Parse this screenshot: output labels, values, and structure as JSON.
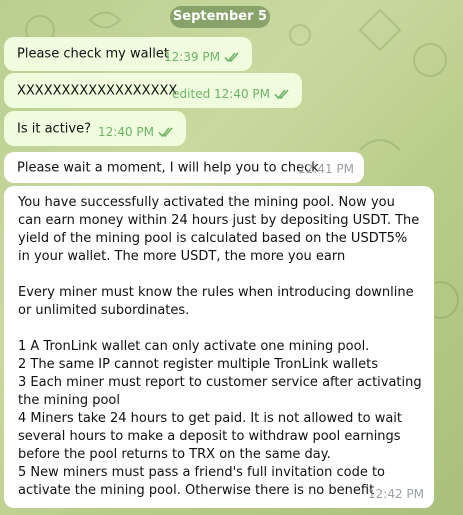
{
  "date": "September 5",
  "messages": [
    {
      "text": "Please check my wallet",
      "time": "12:39 PM"
    },
    {
      "text": "XXXXXXXXXXXXXXXXXX",
      "time": "edited 12:40 PM"
    },
    {
      "text": "Is it active?",
      "time": "12:40 PM"
    },
    {
      "text": "Please wait a moment, I will help you to check",
      "time": "12:41 PM"
    }
  ],
  "long_message": {
    "para1": "You have successfully activated the mining pool. Now you can earn money within 24 hours just by depositing USDT. The yield of the mining pool is calculated based on the USDT5% in your wallet. The more USDT, the more you earn",
    "para2": "Every miner must know the rules when introducing downline or unlimited subordinates.",
    "rule1": "1 A TronLink wallet can only activate one mining pool.",
    "rule2": "2 The same IP cannot register multiple TronLink wallets",
    "rule3": "3 Each miner must report to customer service after activating the mining pool",
    "rule4": "4 Miners take 24 hours to get paid. It is not allowed to wait several hours to make a deposit to withdraw pool earnings before the pool returns to TRX on the same day.",
    "rule5": "5 New miners must pass a friend's full invitation code to activate the mining pool. Otherwise there is no benefit",
    "time": "12:42 PM"
  },
  "colors": {
    "outgoing_bubble": "#effdde",
    "incoming_bubble": "#ffffff",
    "check_color": "#6fb266",
    "date_pill": "#7e9a62"
  }
}
